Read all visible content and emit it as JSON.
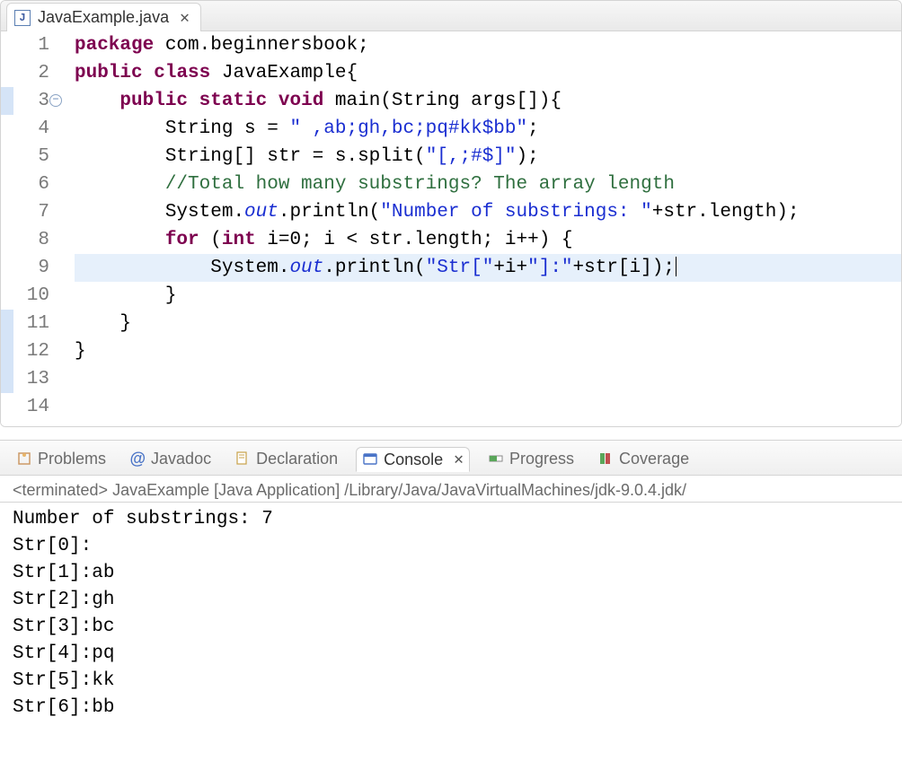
{
  "editor": {
    "tab_title": "JavaExample.java",
    "line_numbers": [
      "1",
      "2",
      "3",
      "4",
      "5",
      "6",
      "7",
      "8",
      "9",
      "10",
      "11",
      "12",
      "13",
      "14"
    ],
    "fold_on_line": 3,
    "highlighted_line": 11,
    "marker_lines": [
      3,
      11,
      12,
      13
    ],
    "code_lines": [
      [
        {
          "cls": "kw",
          "t": "package"
        },
        {
          "cls": "op",
          "t": " "
        },
        {
          "cls": "id",
          "t": "com.beginnersbook;"
        }
      ],
      [
        {
          "cls": "kw",
          "t": "public"
        },
        {
          "cls": "op",
          "t": " "
        },
        {
          "cls": "kw",
          "t": "class"
        },
        {
          "cls": "op",
          "t": " "
        },
        {
          "cls": "id",
          "t": "JavaExample{"
        }
      ],
      [
        {
          "cls": "op",
          "t": "    "
        },
        {
          "cls": "kw",
          "t": "public"
        },
        {
          "cls": "op",
          "t": " "
        },
        {
          "cls": "kw",
          "t": "static"
        },
        {
          "cls": "op",
          "t": " "
        },
        {
          "cls": "kw",
          "t": "void"
        },
        {
          "cls": "op",
          "t": " "
        },
        {
          "cls": "id",
          "t": "main(String args[]){"
        }
      ],
      [
        {
          "cls": "op",
          "t": "        "
        },
        {
          "cls": "id",
          "t": "String s = "
        },
        {
          "cls": "str",
          "t": "\" ,ab;gh,bc;pq#kk$bb\""
        },
        {
          "cls": "op",
          "t": ";"
        }
      ],
      [
        {
          "cls": "op",
          "t": "        "
        },
        {
          "cls": "id",
          "t": "String[] str = s.split("
        },
        {
          "cls": "str",
          "t": "\"[,;#$]\""
        },
        {
          "cls": "op",
          "t": ");"
        }
      ],
      [
        {
          "cls": "op",
          "t": ""
        }
      ],
      [
        {
          "cls": "op",
          "t": "        "
        },
        {
          "cls": "cmt",
          "t": "//Total how many substrings? The array length"
        }
      ],
      [
        {
          "cls": "op",
          "t": "        "
        },
        {
          "cls": "id",
          "t": "System."
        },
        {
          "cls": "field",
          "t": "out"
        },
        {
          "cls": "id",
          "t": ".println("
        },
        {
          "cls": "str",
          "t": "\"Number of substrings: \""
        },
        {
          "cls": "op",
          "t": "+str.length);"
        }
      ],
      [
        {
          "cls": "op",
          "t": ""
        }
      ],
      [
        {
          "cls": "op",
          "t": "        "
        },
        {
          "cls": "kw",
          "t": "for"
        },
        {
          "cls": "op",
          "t": " ("
        },
        {
          "cls": "kw",
          "t": "int"
        },
        {
          "cls": "op",
          "t": " i=0; i < str.length; i++) {"
        }
      ],
      [
        {
          "cls": "op",
          "t": "            "
        },
        {
          "cls": "id",
          "t": "System."
        },
        {
          "cls": "field",
          "t": "out"
        },
        {
          "cls": "id",
          "t": ".println("
        },
        {
          "cls": "str",
          "t": "\"Str[\""
        },
        {
          "cls": "op",
          "t": "+i+"
        },
        {
          "cls": "str",
          "t": "\"]:\""
        },
        {
          "cls": "op",
          "t": "+str[i]);"
        }
      ],
      [
        {
          "cls": "op",
          "t": "        }"
        }
      ],
      [
        {
          "cls": "op",
          "t": "    }"
        }
      ],
      [
        {
          "cls": "op",
          "t": "}"
        }
      ]
    ]
  },
  "bottom_tabs": {
    "problems": "Problems",
    "javadoc": "Javadoc",
    "declaration": "Declaration",
    "console": "Console",
    "progress": "Progress",
    "coverage": "Coverage"
  },
  "console": {
    "status": "<terminated> JavaExample [Java Application] /Library/Java/JavaVirtualMachines/jdk-9.0.4.jdk/",
    "lines": [
      "Number of substrings: 7",
      "Str[0]:",
      "Str[1]:ab",
      "Str[2]:gh",
      "Str[3]:bc",
      "Str[4]:pq",
      "Str[5]:kk",
      "Str[6]:bb"
    ]
  }
}
